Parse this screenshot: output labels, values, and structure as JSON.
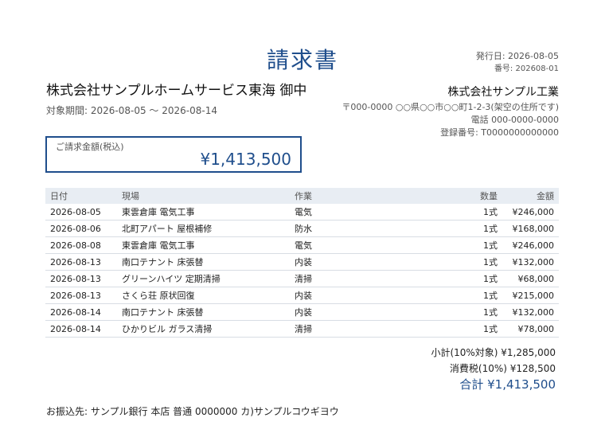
{
  "document": {
    "title": "請求書",
    "issue_date": "発行日: 2026-08-05",
    "invoice_number": "番号: 202608-01"
  },
  "client": {
    "name": "株式会社サンプルホームサービス東海 御中",
    "period": "対象期間: 2026-08-05 〜 2026-08-14"
  },
  "issuer": {
    "name": "株式会社サンプル工業",
    "address": "〒000-0000 ○○県○○市○○町1-2-3(架空の住所です)",
    "phone": "電話 000-0000-0000",
    "registration": "登録番号: T0000000000000"
  },
  "amount_box": {
    "label": "ご請求金額(税込)",
    "value": "¥1,413,500"
  },
  "table": {
    "headers": {
      "date": "日付",
      "site": "現場",
      "work": "作業",
      "qty": "数量",
      "amount": "金額"
    },
    "rows": [
      {
        "date": "2026-08-05",
        "site": "東雲倉庫 電気工事",
        "work": "電気",
        "qty": "1式",
        "amount": "¥246,000"
      },
      {
        "date": "2026-08-06",
        "site": "北町アパート 屋根補修",
        "work": "防水",
        "qty": "1式",
        "amount": "¥168,000"
      },
      {
        "date": "2026-08-08",
        "site": "東雲倉庫 電気工事",
        "work": "電気",
        "qty": "1式",
        "amount": "¥246,000"
      },
      {
        "date": "2026-08-13",
        "site": "南口テナント 床張替",
        "work": "内装",
        "qty": "1式",
        "amount": "¥132,000"
      },
      {
        "date": "2026-08-13",
        "site": "グリーンハイツ 定期清掃",
        "work": "清掃",
        "qty": "1式",
        "amount": "¥68,000"
      },
      {
        "date": "2026-08-13",
        "site": "さくら荘 原状回復",
        "work": "内装",
        "qty": "1式",
        "amount": "¥215,000"
      },
      {
        "date": "2026-08-14",
        "site": "南口テナント 床張替",
        "work": "内装",
        "qty": "1式",
        "amount": "¥132,000"
      },
      {
        "date": "2026-08-14",
        "site": "ひかりビル ガラス清掃",
        "work": "清掃",
        "qty": "1式",
        "amount": "¥78,000"
      }
    ]
  },
  "totals": {
    "subtotal": "小計(10%対象) ¥1,285,000",
    "tax": "消費税(10%) ¥128,500",
    "grand_total": "合計 ¥1,413,500"
  },
  "bank": {
    "text": "お振込先: サンプル銀行 本店 普通 0000000 カ)サンプルコウギヨウ"
  }
}
